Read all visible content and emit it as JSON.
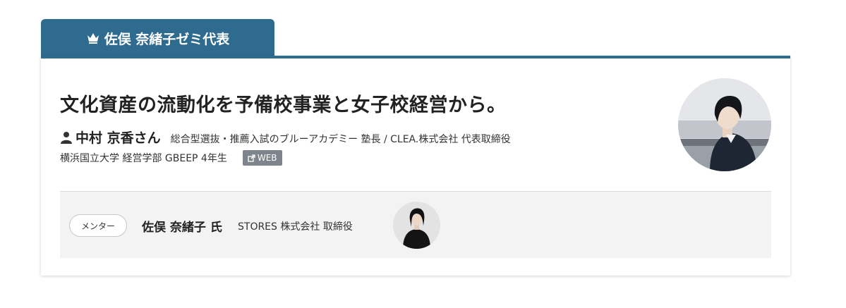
{
  "header": {
    "tab_label": "佐俣 奈緒子ゼミ代表",
    "tab_icon": "crown-icon",
    "accent_color": "#2f6a8f"
  },
  "card": {
    "title": "文化資産の流動化を予備校事業と女子校経営から。",
    "person": {
      "icon": "person-icon",
      "name": "中村 京香さん",
      "role": "総合型選抜・推薦入試のブルーアカデミー 塾長 / CLEA.株式会社 代表取締役",
      "university": "横浜国立大学 経営学部 GBEEP 4年生",
      "web_label": "WEB"
    }
  },
  "mentor": {
    "badge": "メンター",
    "name": "佐俣 奈緒子 氏",
    "role": "STORES 株式会社 取締役"
  }
}
